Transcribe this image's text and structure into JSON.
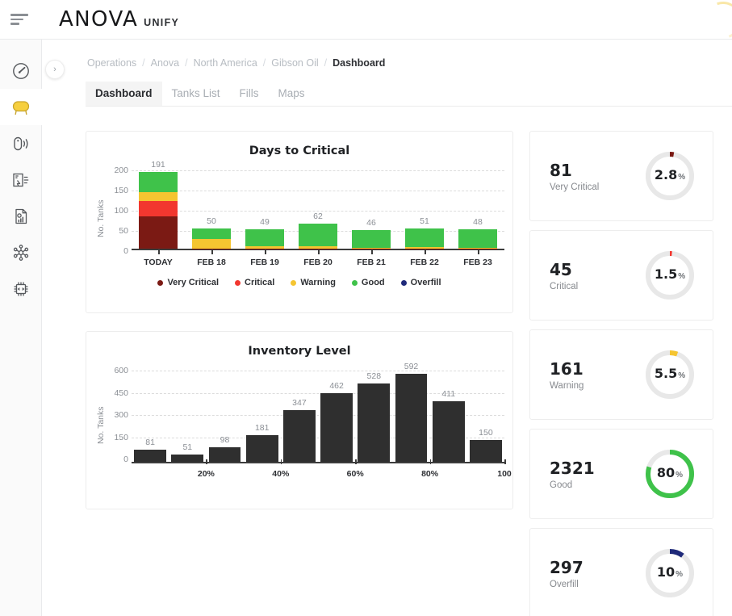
{
  "header": {
    "menu_icon": "hamburger-icon",
    "brand_main": "ANOVA",
    "brand_sub": "UNIFY",
    "spinner": "loading-spinner"
  },
  "sidebar": {
    "items": [
      {
        "icon": "gauge-icon",
        "name": "dashboard",
        "active": false
      },
      {
        "icon": "tank-icon",
        "name": "tanks",
        "active": true
      },
      {
        "icon": "sensor-icon",
        "name": "sensors",
        "active": false
      },
      {
        "icon": "fills-icon",
        "name": "fills",
        "active": false
      },
      {
        "icon": "reports-icon",
        "name": "reports",
        "active": false
      },
      {
        "icon": "network-icon",
        "name": "network",
        "active": false
      },
      {
        "icon": "device-icon",
        "name": "devices",
        "active": false
      }
    ],
    "collapse_toggle": "›"
  },
  "breadcrumb": {
    "separator": "/",
    "items": [
      "Operations",
      "Anova",
      "North America",
      "Gibson Oil"
    ],
    "current": "Dashboard"
  },
  "tabs": [
    {
      "label": "Dashboard",
      "active": true
    },
    {
      "label": "Tanks List",
      "active": false
    },
    {
      "label": "Fills",
      "active": false
    },
    {
      "label": "Maps",
      "active": false
    }
  ],
  "colors": {
    "very_critical": "#7B1A14",
    "critical": "#F2372F",
    "warning": "#F5C531",
    "good": "#3FC24A",
    "overfill": "#1F2A7A",
    "inventory_bar": "#2F2F2F",
    "axis": "#3C3C3C",
    "grid": "#DCDCDC"
  },
  "chart_data": [
    {
      "type": "bar",
      "stacked": true,
      "title": "Days to Critical",
      "xlabel": "",
      "ylabel": "No. Tanks",
      "ylim": [
        0,
        200
      ],
      "yticks": [
        0,
        50,
        100,
        150,
        200
      ],
      "grid": true,
      "legend_position": "bottom",
      "categories": [
        "TODAY",
        "FEB 18",
        "FEB 19",
        "FEB 20",
        "FEB 21",
        "FEB 22",
        "FEB 23"
      ],
      "totals": [
        191,
        50,
        49,
        62,
        46,
        51,
        48
      ],
      "series": [
        {
          "name": "Very Critical",
          "color": "#7B1A14",
          "values": [
            80,
            1,
            1,
            1,
            1,
            1,
            1
          ]
        },
        {
          "name": "Critical",
          "color": "#F2372F",
          "values": [
            38,
            0,
            0,
            0,
            0,
            0,
            0
          ]
        },
        {
          "name": "Warning",
          "color": "#F5C531",
          "values": [
            22,
            24,
            6,
            5,
            2,
            4,
            1
          ]
        },
        {
          "name": "Good",
          "color": "#3FC24A",
          "values": [
            51,
            25,
            42,
            56,
            43,
            46,
            46
          ]
        },
        {
          "name": "Overfill",
          "color": "#1F2A7A",
          "values": [
            0,
            0,
            0,
            0,
            0,
            0,
            0
          ]
        }
      ]
    },
    {
      "type": "bar",
      "stacked": false,
      "title": "Inventory Level",
      "xlabel": "",
      "ylabel": "No. Tanks",
      "ylim": [
        0,
        600
      ],
      "yticks": [
        0,
        150,
        300,
        450,
        600
      ],
      "grid": true,
      "xticks": [
        "20%",
        "40%",
        "60%",
        "80%",
        "100"
      ],
      "values": [
        81,
        51,
        98,
        181,
        347,
        462,
        528,
        592,
        411,
        150
      ],
      "bar_color": "#2F2F2F"
    }
  ],
  "kpi_cards": [
    {
      "value": "81",
      "label": "Very Critical",
      "percent": "2.8",
      "percent_symbol": "%",
      "arc": 2.8,
      "color": "#7B1A14"
    },
    {
      "value": "45",
      "label": "Critical",
      "percent": "1.5",
      "percent_symbol": "%",
      "arc": 1.5,
      "color": "#F2372F"
    },
    {
      "value": "161",
      "label": "Warning",
      "percent": "5.5",
      "percent_symbol": "%",
      "arc": 5.5,
      "color": "#F5C531"
    },
    {
      "value": "2321",
      "label": "Good",
      "percent": "80",
      "percent_symbol": "%",
      "arc": 80,
      "color": "#3FC24A"
    },
    {
      "value": "297",
      "label": "Overfill",
      "percent": "10",
      "percent_symbol": "%",
      "arc": 10,
      "color": "#1F2A7A"
    }
  ]
}
